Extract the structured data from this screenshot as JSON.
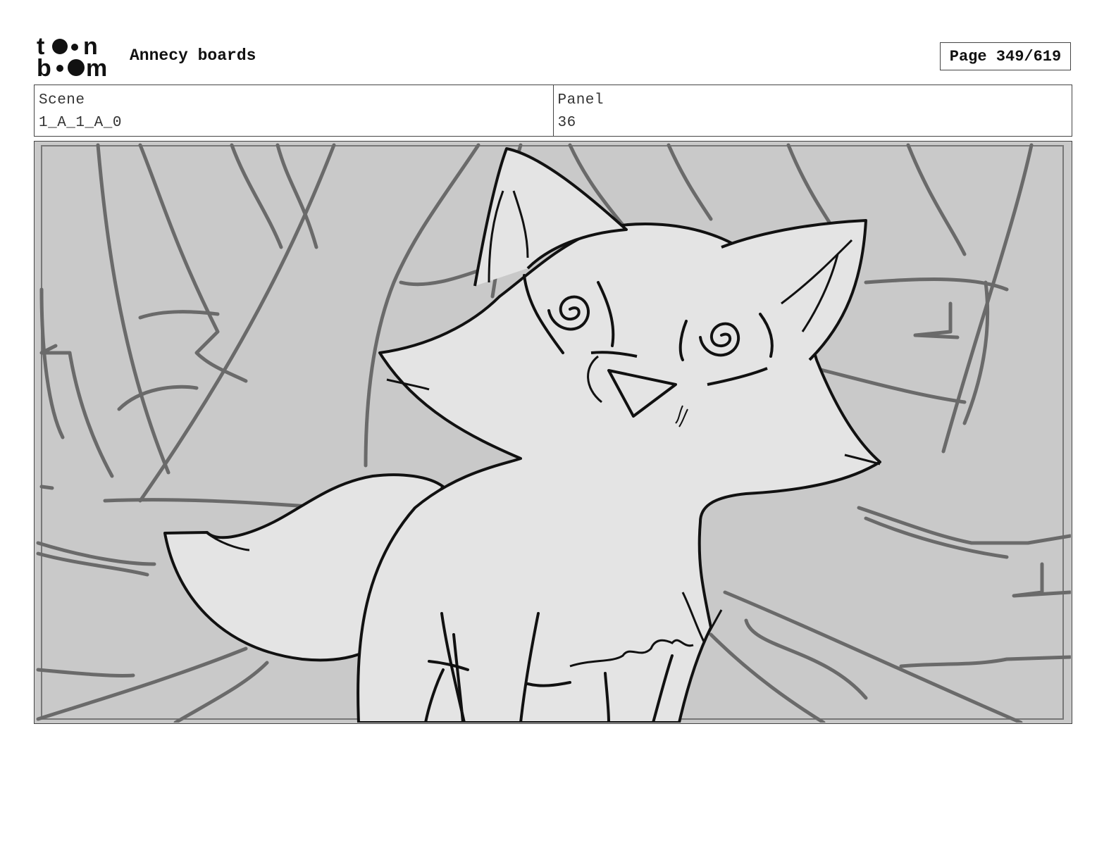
{
  "header": {
    "logo_text_top": "toon",
    "logo_text_bottom": "boom",
    "title": "Annecy boards",
    "page_label": "Page 349/619"
  },
  "info": {
    "scene_label": "Scene",
    "scene_value": "1_A_1_A_0",
    "panel_label": "Panel",
    "panel_value": "36"
  },
  "colors": {
    "background_sketch": "#c9c9c9",
    "fox_fill": "#e4e4e4",
    "line": "#111111",
    "tree_line": "#666666"
  }
}
